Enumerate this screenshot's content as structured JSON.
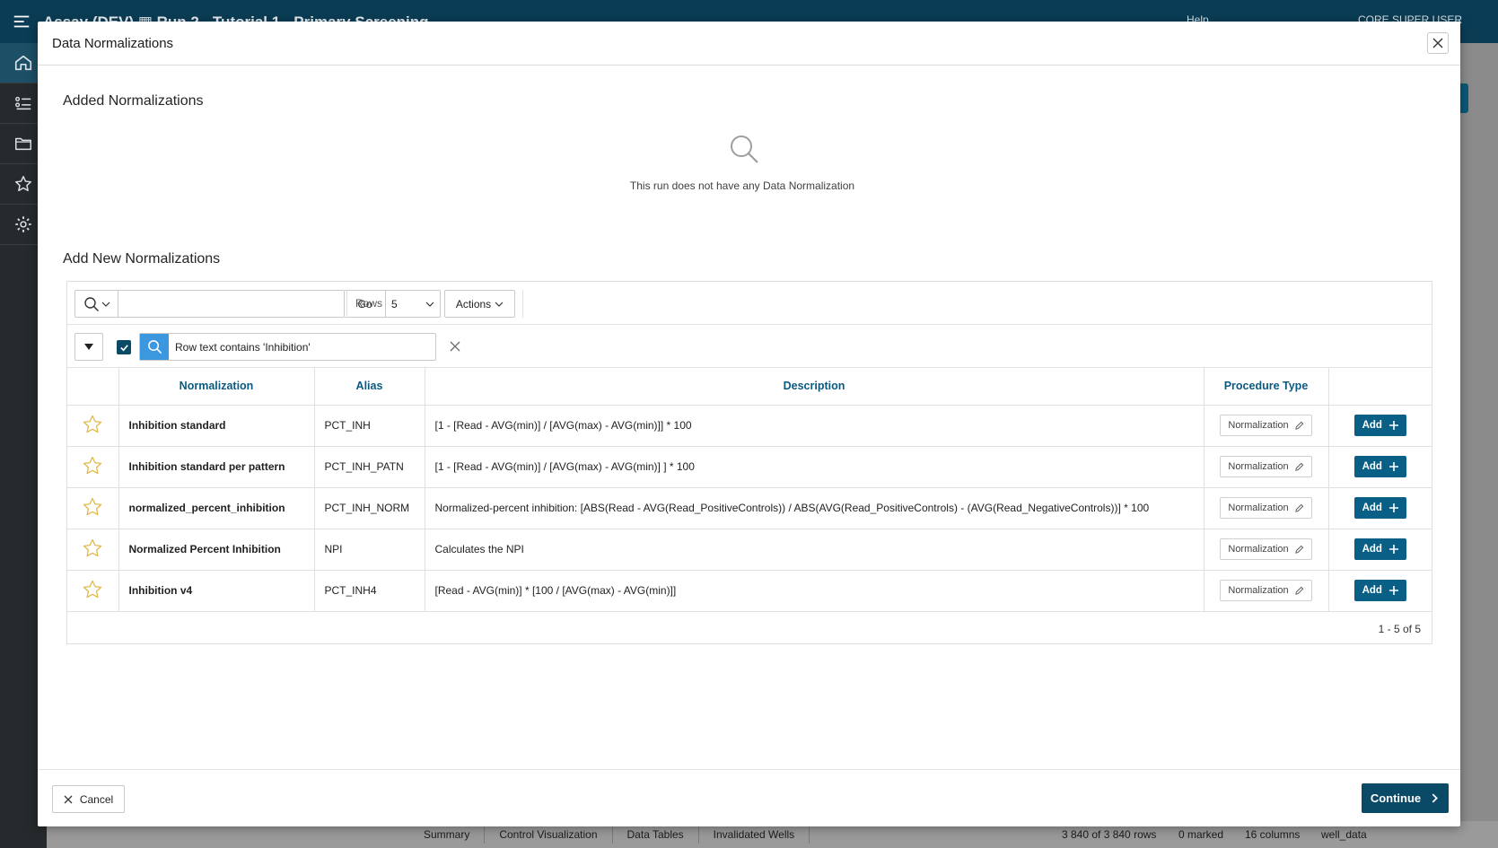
{
  "app": {
    "title": "Assay (DEV)  ▦  Run 2 - Tutorial 1 - Primary Screening",
    "header_help": "Help",
    "header_user": "CORE SUPER USER"
  },
  "status_bar": {
    "tabs": [
      "Summary",
      "Control Visualization",
      "Data Tables",
      "Invalidated Wells"
    ],
    "rows": "3 840 of 3 840 rows",
    "marked": "0 marked",
    "columns": "16 columns",
    "table": "well_data"
  },
  "dialog": {
    "title": "Data Normalizations",
    "added_section_title": "Added Normalizations",
    "empty_message": "This run does not have any Data Normalization",
    "add_section_title": "Add New Normalizations",
    "toolbar": {
      "search_value": "",
      "go_label": "Go",
      "rows_label": "Rows",
      "rows_value": "5",
      "actions_label": "Actions"
    },
    "filter": {
      "text": "Row text contains 'Inhibition'"
    },
    "columns": {
      "normalization": "Normalization",
      "alias": "Alias",
      "description": "Description",
      "procedure_type": "Procedure Type"
    },
    "rows": [
      {
        "name": "Inhibition standard",
        "alias": "PCT_INH",
        "description": "[1 - [Read - AVG(min)] / [AVG(max) - AVG(min)]] * 100",
        "procedure_type": "Normalization",
        "add_label": "Add"
      },
      {
        "name": "Inhibition standard per pattern",
        "alias": "PCT_INH_PATN",
        "description": "[1 - [Read - AVG(min)] / [AVG(max) - AVG(min)] ] * 100",
        "procedure_type": "Normalization",
        "add_label": "Add"
      },
      {
        "name": "normalized_percent_inhibition",
        "alias": "PCT_INH_NORM",
        "description": "Normalized-percent inhibition: [ABS(Read - AVG(Read_PositiveControls)) / ABS(AVG(Read_PositiveControls) - (AVG(Read_NegativeControls))] * 100",
        "procedure_type": "Normalization",
        "add_label": "Add"
      },
      {
        "name": "Normalized Percent Inhibition",
        "alias": "NPI",
        "description": "Calculates the NPI",
        "procedure_type": "Normalization",
        "add_label": "Add"
      },
      {
        "name": "Inhibition v4",
        "alias": "PCT_INH4",
        "description": "[Read - AVG(min)] * [100 / [AVG(max) - AVG(min)]]",
        "procedure_type": "Normalization",
        "add_label": "Add"
      }
    ],
    "pagination": "1 - 5 of 5",
    "cancel_label": "Cancel",
    "continue_label": "Continue"
  },
  "colors": {
    "header_bg": "#0a3d55",
    "primary_button": "#0a5f86",
    "continue_button": "#0a4a66",
    "column_header_text": "#0a5a80",
    "filter_icon_bg": "#3b98df",
    "star_outline": "#e0b94a"
  },
  "icons": {
    "menu": "hamburger-icon",
    "home": "home-icon",
    "list": "list-icon",
    "folder": "folder-icon",
    "star": "star-icon",
    "settings": "gear-icon",
    "search": "search-icon",
    "close": "close-icon",
    "edit": "pencil-icon",
    "add": "plus-icon",
    "continue": "chevron-right-icon"
  }
}
